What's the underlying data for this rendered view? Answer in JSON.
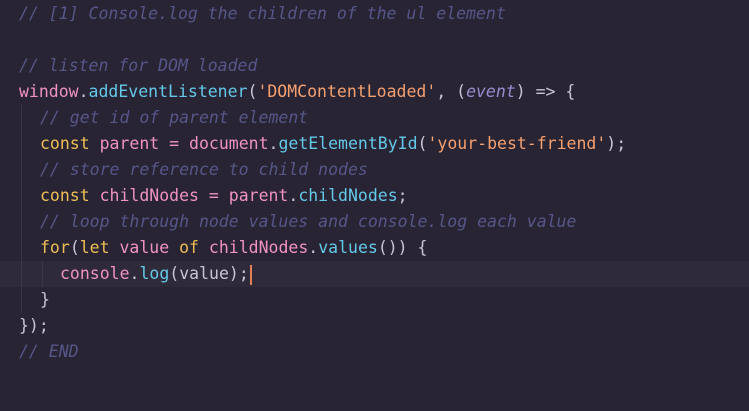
{
  "lines": [
    {
      "text": "// [1] Console.log the children of the ul element"
    },
    {
      "text": ""
    },
    {
      "text": "// listen for DOM loaded"
    },
    {
      "p1": "window",
      "p2": ".",
      "p3": "addEventListener",
      "p4": "(",
      "p5": "'DOMContentLoaded'",
      "p6": ", (",
      "p7": "event",
      "p8": ") => {"
    },
    {
      "text": "// get id of parent element"
    },
    {
      "p1": "const",
      "p2": "parent",
      "p3": "=",
      "p4": "document",
      "p5": ".",
      "p6": "getElementById",
      "p7": "(",
      "p8": "'your-best-friend'",
      "p9": ");"
    },
    {
      "text": "// store reference to child nodes"
    },
    {
      "p1": "const",
      "p2": "childNodes",
      "p3": "=",
      "p4": "parent",
      "p5": ".",
      "p6": "childNodes",
      "p7": ";"
    },
    {
      "text": "// loop through node values and console.log each value"
    },
    {
      "p1": "for",
      "p2": "(",
      "p3": "let",
      "p4": "value",
      "p5": "of",
      "p6": "childNodes",
      "p7": ".",
      "p8": "values",
      "p9": "()) {"
    },
    {
      "p1": "console",
      "p2": ".",
      "p3": "log",
      "p4": "(value);"
    },
    {
      "text": "}"
    },
    {
      "text": "});"
    },
    {
      "text": "// END"
    }
  ],
  "colors": {
    "background": "#282433",
    "comment": "#56568a",
    "keyword": "#eebf56",
    "identifier": "#f092c4",
    "function": "#64c8e8",
    "string": "#f5a070",
    "cursor": "#e0805a"
  }
}
